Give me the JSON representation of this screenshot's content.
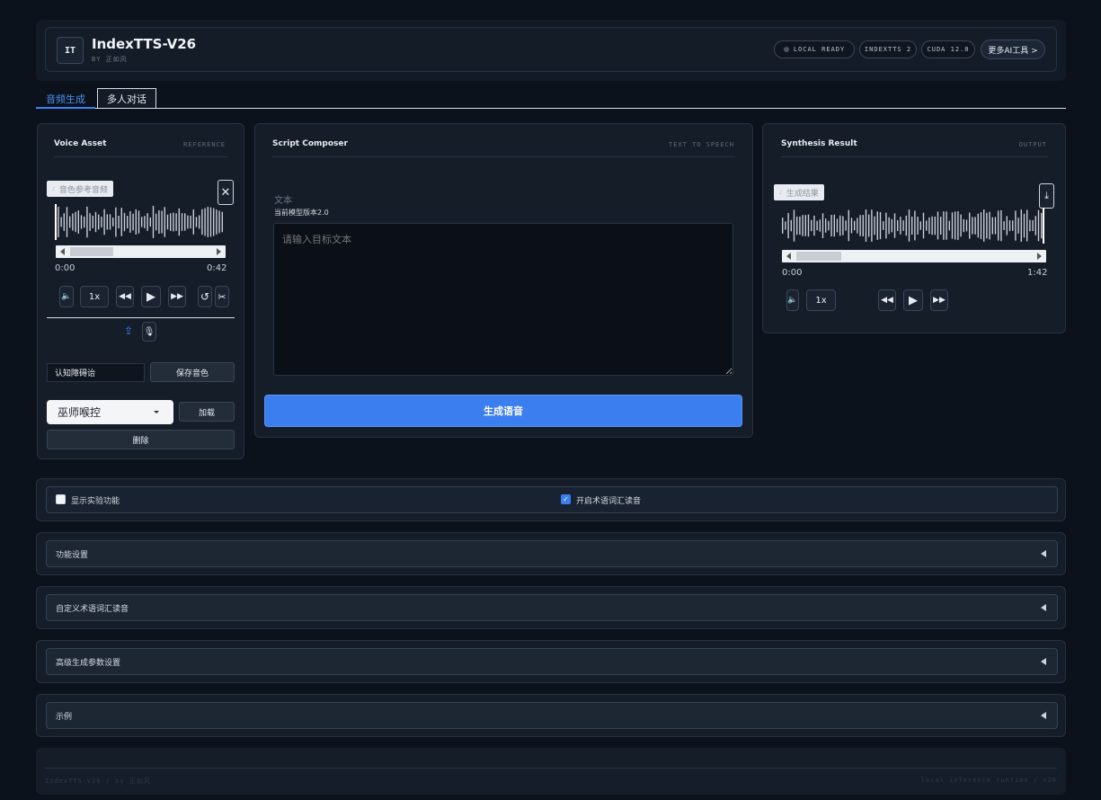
{
  "header": {
    "logo": "IT",
    "title": "IndexTTS-V26",
    "subtitle": "BY 正如风",
    "badges": [
      "LOCAL READY",
      "INDEXTTS 2",
      "CUDA 12.8"
    ],
    "more_tools": "更多AI工具 >"
  },
  "tabs": {
    "audio": "音频生成",
    "dialog": "多人对话"
  },
  "voice": {
    "title": "Voice Asset",
    "tag": "REFERENCE",
    "chip": "音色参考音频",
    "chip_icon": "music-icon",
    "time_start": "0:00",
    "time_end": "0:42",
    "speed": "1x",
    "progress_fraction": 0.08,
    "name_value": "认知障碍诒",
    "save_label": "保存音色",
    "select_value": "巫师喉控",
    "load_label": "加载",
    "delete_label": "删除"
  },
  "script": {
    "title": "Script Composer",
    "tag": "TEXT TO SPEECH",
    "text_label": "文本",
    "version": "当前模型版本2.0",
    "placeholder": "请输入目标文本",
    "generate_label": "生成语音"
  },
  "result": {
    "title": "Synthesis Result",
    "tag": "OUTPUT",
    "chip": "生成结果",
    "chip_icon": "music-icon",
    "time_start": "0:00",
    "time_end": "1:42",
    "speed": "1x",
    "progress_fraction": 0.06
  },
  "options": {
    "experimental": {
      "label": "显示实验功能",
      "checked": false
    },
    "glossary": {
      "label": "开启术语词汇读音",
      "checked": true
    }
  },
  "accordions": [
    "功能设置",
    "自定义术语词汇读音",
    "高级生成参数设置",
    "示例"
  ],
  "footer": {
    "left": "IndexTTS-V26 / by 正如风",
    "right": "local inference runtime / v26"
  },
  "colors": {
    "accent": "#3b7ef0",
    "background": "#0c121b",
    "panel": "#151d28"
  }
}
